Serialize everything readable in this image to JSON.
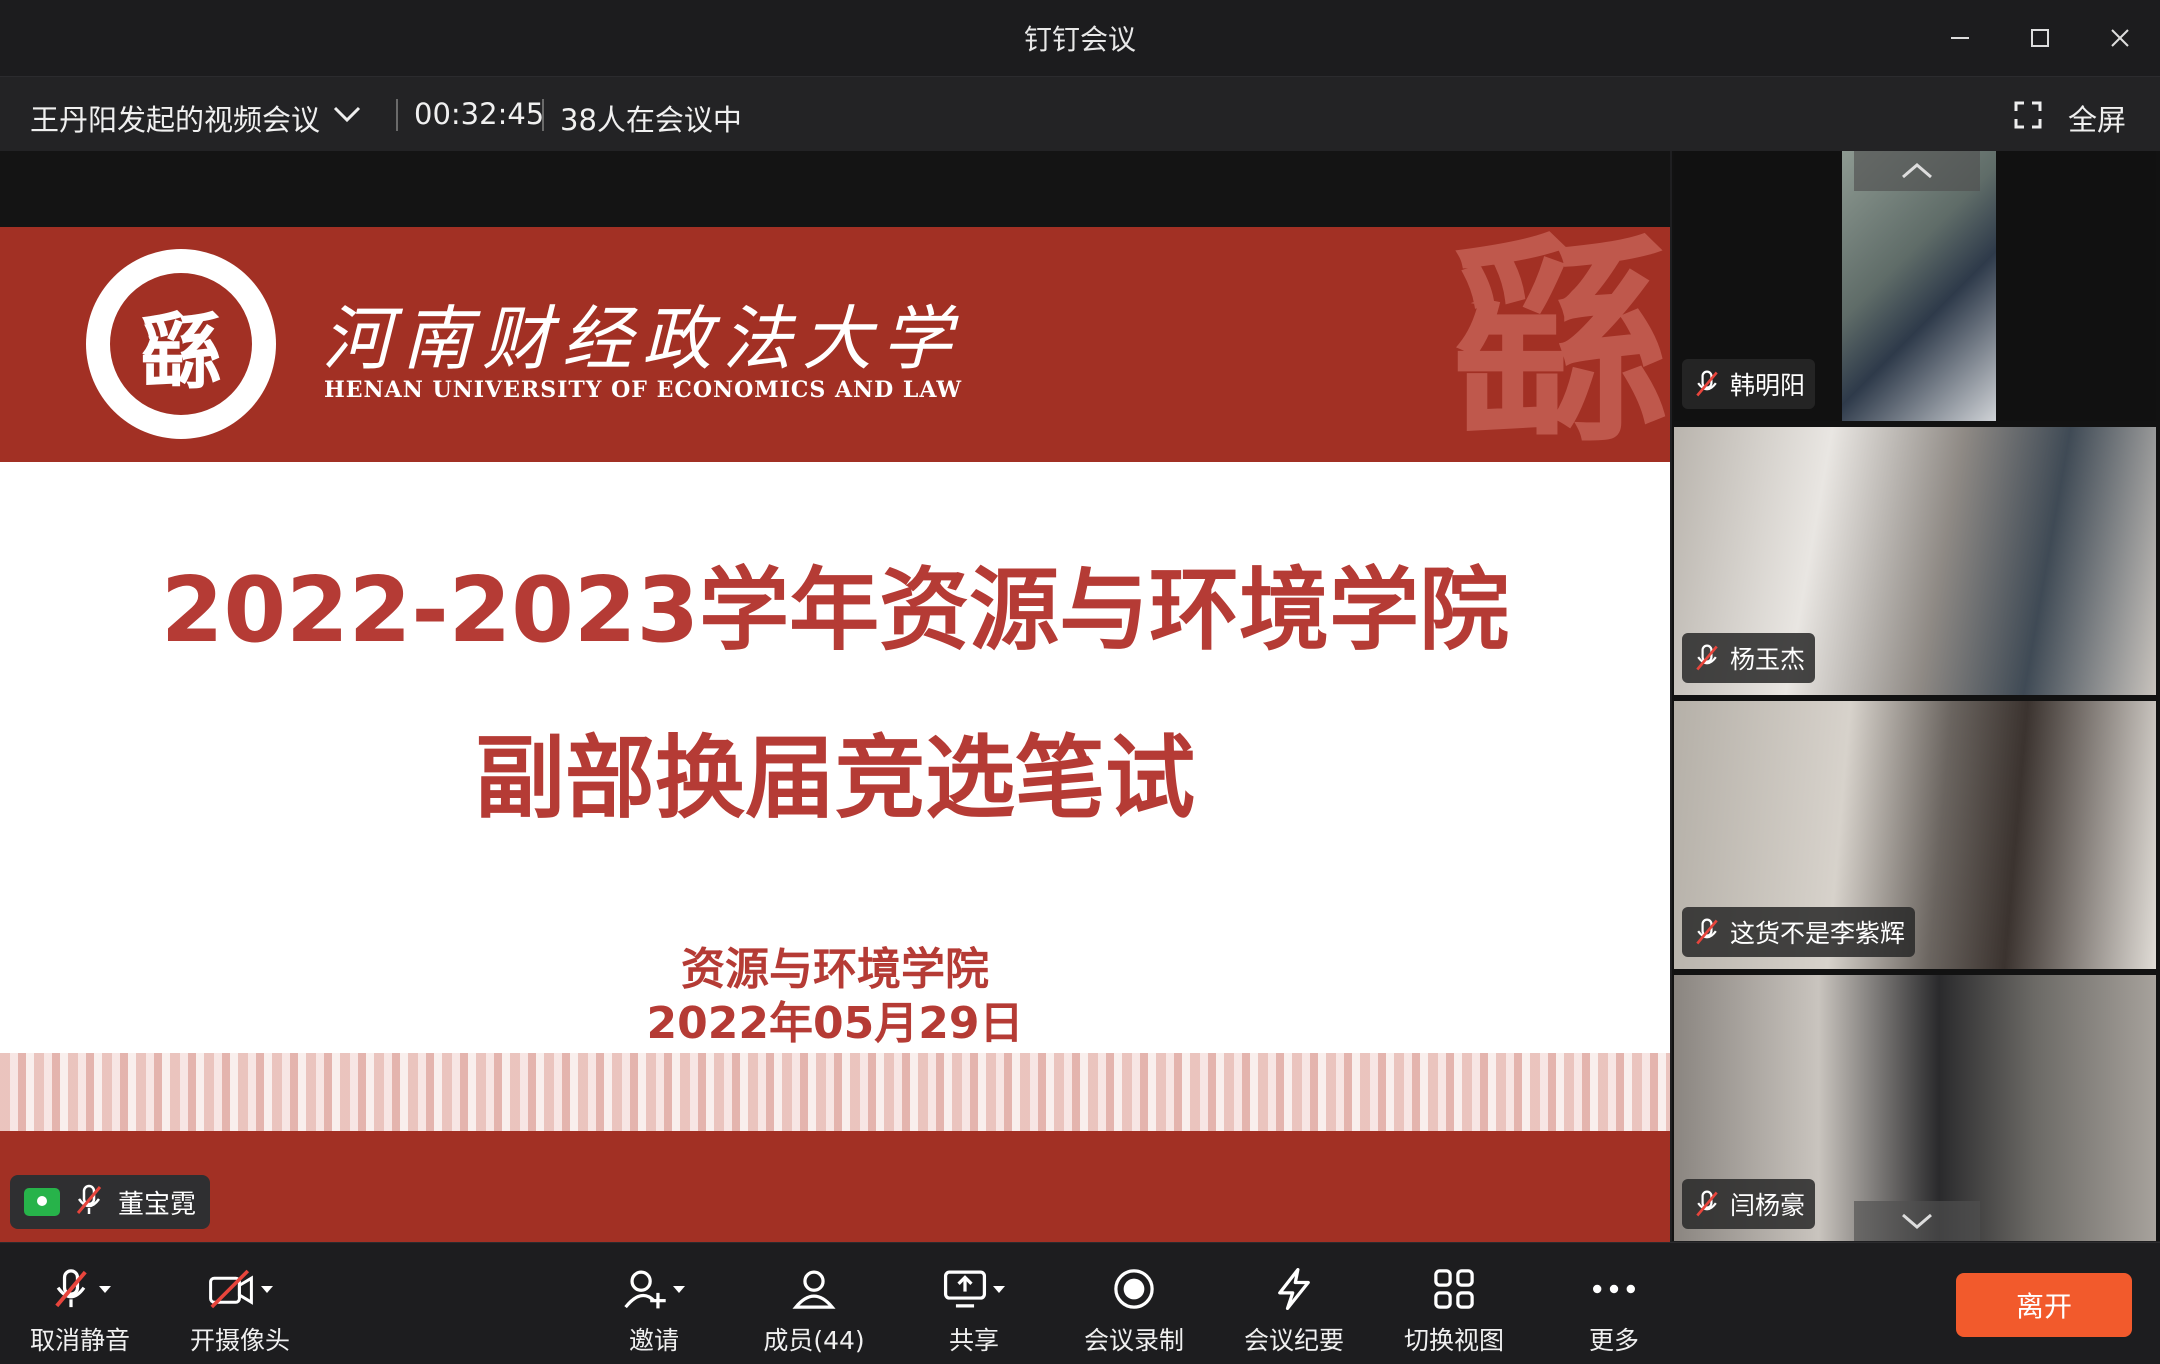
{
  "window": {
    "title": "钉钉会议"
  },
  "meeting_bar": {
    "meeting_name": "王丹阳发起的视频会议",
    "duration": "00:32:45",
    "participants_status": "38人在会议中",
    "fullscreen_label": "全屏"
  },
  "slide": {
    "university_cn": "河南财经政法大学",
    "university_en": "HENAN UNIVERSITY OF ECONOMICS AND LAW",
    "seal_text": "HENAN UNIVERSITY OF ECONOMICS AND LAW",
    "emblem_glyph": "繇",
    "title_line1": "2022-2023学年资源与环境学院",
    "title_line2": "副部换届竞选笔试",
    "department": "资源与环境学院",
    "date": "2022年05月29日"
  },
  "presenter": {
    "name": "董宝霓"
  },
  "participants": [
    {
      "name": "韩明阳"
    },
    {
      "name": "杨玉杰"
    },
    {
      "name": "这货不是李紫辉"
    },
    {
      "name": "闫杨豪"
    }
  ],
  "toolbar": {
    "mute": "取消静音",
    "camera": "开摄像头",
    "invite": "邀请",
    "members": "成员(44)",
    "share": "共享",
    "record": "会议录制",
    "notes": "会议纪要",
    "switch_view": "切换视图",
    "more": "更多",
    "leave": "离开"
  },
  "colors": {
    "slide_red": "#a23024",
    "title_red": "#b53b35",
    "leave_orange": "#f25a2c",
    "share_green": "#27b34a",
    "mute_red": "#e8453c"
  }
}
